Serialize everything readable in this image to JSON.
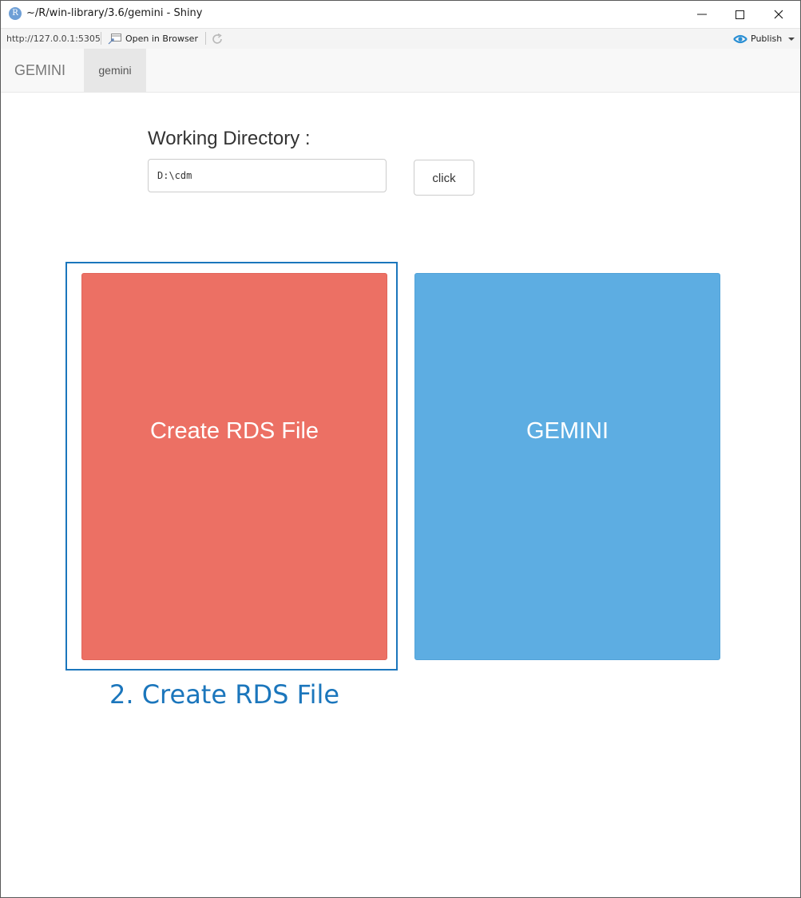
{
  "window": {
    "title": "~/R/win-library/3.6/gemini - Shiny",
    "logo_glyph": "R"
  },
  "toolbar": {
    "url": "http://127.0.0.1:5305",
    "open_in_browser": "Open in Browser",
    "publish": "Publish"
  },
  "navbar": {
    "brand": "GEMINI",
    "tabs": [
      {
        "label": "gemini",
        "active": true
      }
    ]
  },
  "main": {
    "working_directory_label": "Working Directory :",
    "working_directory_value": "D:\\cdm",
    "click_button": "click",
    "tiles": [
      {
        "label": "Create RDS File",
        "color": "#ec7064"
      },
      {
        "label": "GEMINI",
        "color": "#5dade2"
      }
    ],
    "caption": "2. Create RDS File",
    "highlight_color": "#1b76bc"
  },
  "icons": {
    "app": "r-logo-icon",
    "open_browser": "open-in-browser-icon",
    "refresh": "refresh-icon",
    "publish": "publish-icon",
    "minimize": "minimize-icon",
    "maximize": "maximize-icon",
    "close": "close-icon"
  }
}
